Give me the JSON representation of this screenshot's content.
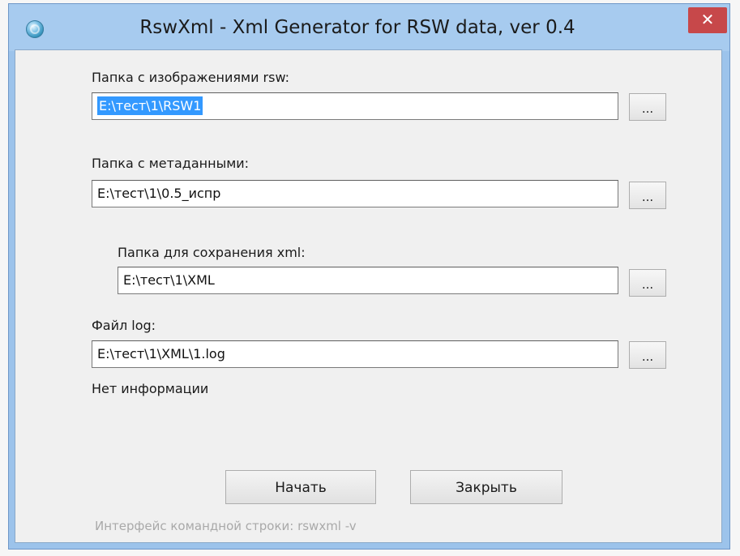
{
  "window": {
    "title": "RswXml - Xml Generator for RSW data, ver 0.4",
    "close_glyph": "✕"
  },
  "fields": {
    "images": {
      "label": "Папка с изображениями rsw:",
      "value": "E:\\тест\\1\\RSW1",
      "selected": true
    },
    "metadata": {
      "label": "Папка с метаданными:",
      "value": "E:\\тест\\1\\0.5_испр"
    },
    "save_xml": {
      "label": "Папка для сохранения xml:",
      "value": "E:\\тест\\1\\XML"
    },
    "log": {
      "label": "Файл log:",
      "value": "E:\\тест\\1\\XML\\1.log"
    }
  },
  "browse_label": "...",
  "status": "Нет информации",
  "buttons": {
    "start": "Начать",
    "close": "Закрыть"
  },
  "hint": "Интерфейс командной строки: rswxml -v",
  "colors": {
    "title_bar": "#a7cbef",
    "close": "#c7484a",
    "selection": "#3399ff"
  },
  "icons": {
    "app": "globe-icon",
    "close": "close-icon"
  }
}
